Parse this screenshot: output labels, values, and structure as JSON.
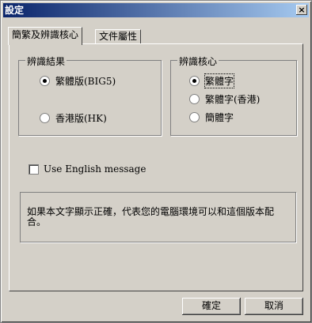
{
  "window": {
    "title": "設定",
    "close_symbol": "×"
  },
  "tabs": [
    {
      "label": "簡繁及辨識核心"
    },
    {
      "label": "文件屬性"
    }
  ],
  "group_result": {
    "label": "辨識結果",
    "options": [
      {
        "label": "繁體版(BIG5)",
        "checked": true
      },
      {
        "label": "香港版(HK)",
        "checked": false
      }
    ]
  },
  "group_core": {
    "label": "辨識核心",
    "options": [
      {
        "label": "繁體字",
        "checked": true
      },
      {
        "label": "繁體字(香港)",
        "checked": false
      },
      {
        "label": "簡體字",
        "checked": false
      }
    ]
  },
  "english_message": {
    "label": "Use English message",
    "checked": false
  },
  "message": {
    "text": "如果本文字顯示正確，代表您的電腦環境可以和這個版本配合。"
  },
  "buttons": {
    "ok": "確定",
    "cancel": "取消"
  }
}
